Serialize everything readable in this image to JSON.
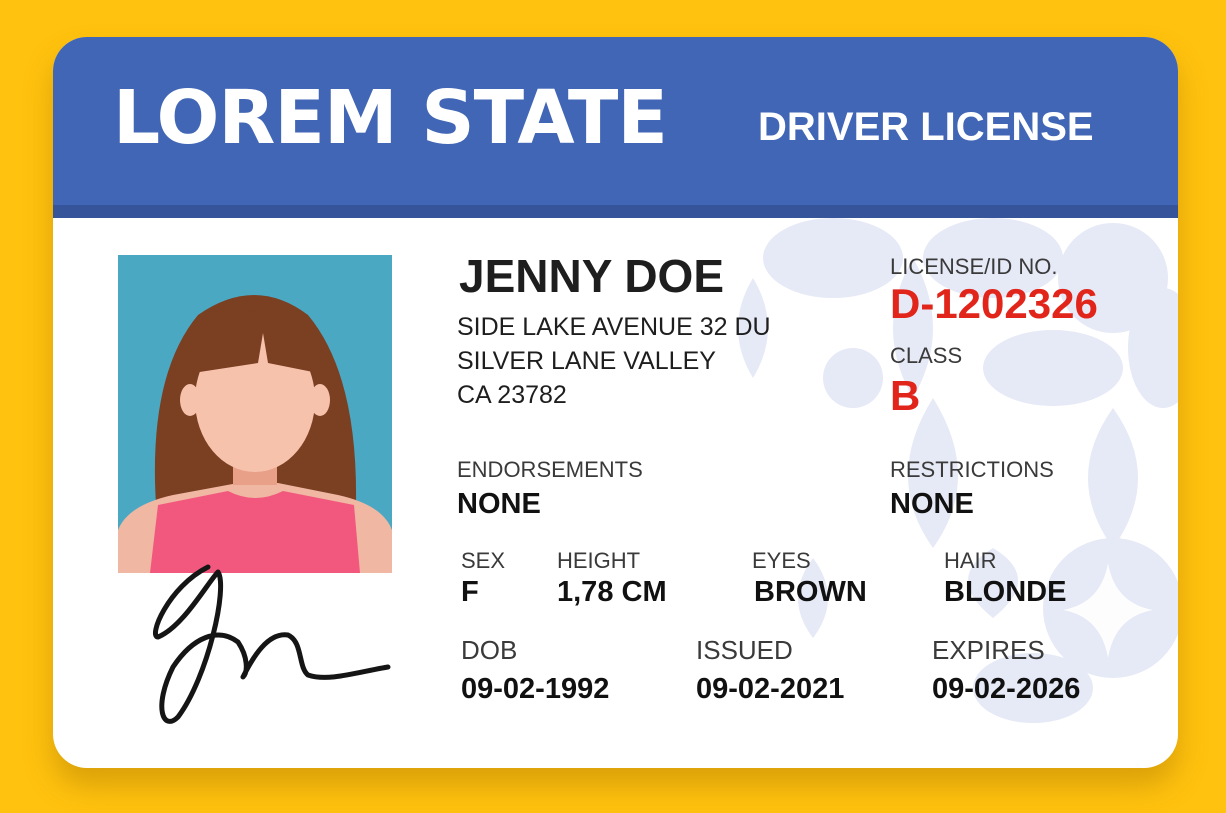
{
  "header": {
    "state": "LOREM STATE",
    "doc_type": "DRIVER LICENSE"
  },
  "holder": {
    "name": "JENNY DOE",
    "address_line1": "SIDE LAKE AVENUE 32 DU",
    "address_line2": "SILVER LANE VALLEY",
    "address_line3": "CA 23782"
  },
  "license": {
    "id_label": "LICENSE/ID NO.",
    "id_value": "D-1202326",
    "class_label": "CLASS",
    "class_value": "B"
  },
  "endorsements": {
    "label": "ENDORSEMENTS",
    "value": "NONE"
  },
  "restrictions": {
    "label": "RESTRICTIONS",
    "value": "NONE"
  },
  "physical": {
    "sex_label": "SEX",
    "sex_value": "F",
    "height_label": "HEIGHT",
    "height_value": "1,78 CM",
    "eyes_label": "EYES",
    "eyes_value": "BROWN",
    "hair_label": "HAIR",
    "hair_value": "BLONDE"
  },
  "dates": {
    "dob_label": "DOB",
    "dob_value": "09-02-1992",
    "issued_label": "ISSUED",
    "issued_value": "09-02-2021",
    "expires_label": "EXPIRES",
    "expires_value": "09-02-2026"
  },
  "colors": {
    "background": "#FFC20E",
    "header": "#4266B6",
    "accent_red": "#E1251B",
    "pattern": "#E4E8F5"
  },
  "icons": [
    "portrait-avatar-icon",
    "signature-icon",
    "background-pattern"
  ]
}
